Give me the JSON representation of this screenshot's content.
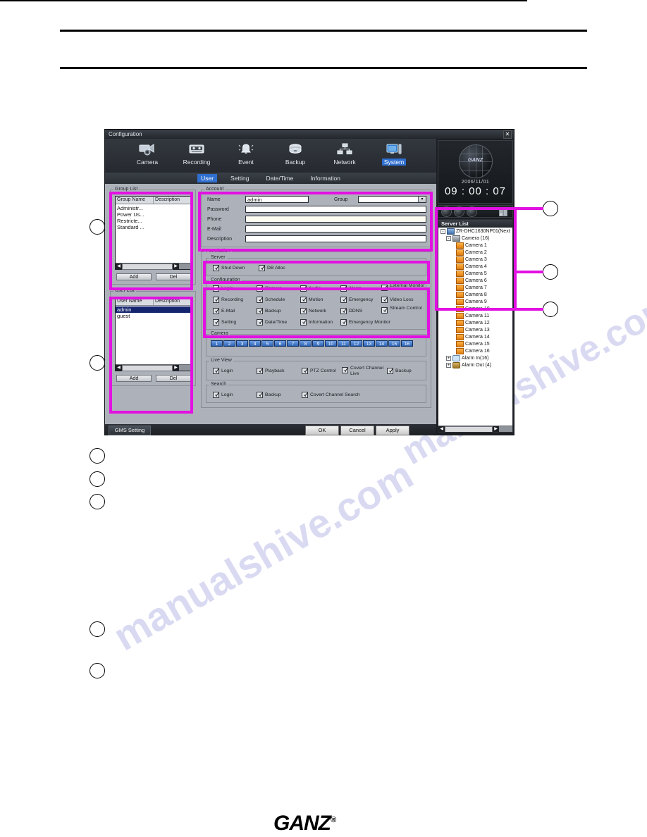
{
  "document": {
    "watermark": "manualshive.com",
    "footer_logo": "GANZ",
    "footer_logo_mark": "®"
  },
  "window": {
    "title": "Configuration",
    "close_label": "✕"
  },
  "toolbar": {
    "items": [
      {
        "label": "Camera",
        "icon": "camera-icon",
        "active": false
      },
      {
        "label": "Recording",
        "icon": "tape-icon",
        "active": false
      },
      {
        "label": "Event",
        "icon": "bell-icon",
        "active": false
      },
      {
        "label": "Backup",
        "icon": "disc-stack-icon",
        "active": false
      },
      {
        "label": "Network",
        "icon": "network-icon",
        "active": false
      },
      {
        "label": "System",
        "icon": "monitor-icon",
        "active": true
      }
    ]
  },
  "subtabs": [
    {
      "label": "User",
      "active": true
    },
    {
      "label": "Setting",
      "active": false
    },
    {
      "label": "Date/Time",
      "active": false
    },
    {
      "label": "Information",
      "active": false
    }
  ],
  "group_list": {
    "title": "Group List",
    "columns": [
      "Group Name",
      "Description"
    ],
    "rows": [
      "Administr...",
      "Power Us...",
      "Restricte...",
      "Standard ..."
    ],
    "add_label": "Add",
    "del_label": "Del"
  },
  "user_list": {
    "title": "User List",
    "columns": [
      "User Name",
      "Description"
    ],
    "rows": [
      {
        "name": "admin",
        "selected": true
      },
      {
        "name": "guest",
        "selected": false
      }
    ],
    "add_label": "Add",
    "del_label": "Del"
  },
  "account": {
    "title": "Account",
    "fields": [
      {
        "label": "Name",
        "value": "admin"
      },
      {
        "label": "Password",
        "value": ""
      },
      {
        "label": "Phone",
        "value": ""
      },
      {
        "label": "E-Mail",
        "value": ""
      },
      {
        "label": "Description",
        "value": ""
      }
    ],
    "group_label": "Group",
    "group_value": ""
  },
  "permission": {
    "title": "Permission",
    "server": {
      "title": "Server",
      "items": [
        {
          "label": "Shut Down",
          "checked": true
        },
        {
          "label": "DB Alloc",
          "checked": true
        }
      ]
    },
    "configuration": {
      "title": "Configuration",
      "items": [
        {
          "label": "Login",
          "checked": true
        },
        {
          "label": "Camera",
          "checked": true
        },
        {
          "label": "Audio",
          "checked": true
        },
        {
          "label": "Alarm",
          "checked": true
        },
        {
          "label": "External Monitor",
          "checked": true
        },
        {
          "label": "Recording",
          "checked": true
        },
        {
          "label": "Schedule",
          "checked": true
        },
        {
          "label": "Motion",
          "checked": true
        },
        {
          "label": "Emergency",
          "checked": true
        },
        {
          "label": "Video Loss",
          "checked": true
        },
        {
          "label": "E-Mail",
          "checked": true
        },
        {
          "label": "Backup",
          "checked": true
        },
        {
          "label": "Network",
          "checked": true
        },
        {
          "label": "DDNS",
          "checked": true
        },
        {
          "label": "Stream Control",
          "checked": true
        },
        {
          "label": "Setting",
          "checked": true
        },
        {
          "label": "Date/Time",
          "checked": true
        },
        {
          "label": "Information",
          "checked": true
        },
        {
          "label": "Emergency Monitor",
          "checked": true
        }
      ]
    },
    "camera": {
      "title": "Camera",
      "channels": [
        "1",
        "2",
        "3",
        "4",
        "5",
        "6",
        "7",
        "8",
        "9",
        "10",
        "11",
        "12",
        "13",
        "14",
        "15",
        "16"
      ]
    },
    "live_view": {
      "title": "Live View",
      "items": [
        {
          "label": "Login",
          "checked": true
        },
        {
          "label": "Playback",
          "checked": true
        },
        {
          "label": "PTZ Control",
          "checked": true
        },
        {
          "label": "Covert Channel Live",
          "checked": true
        },
        {
          "label": "Backup",
          "checked": true
        }
      ]
    },
    "search": {
      "title": "Search",
      "items": [
        {
          "label": "Login",
          "checked": true
        },
        {
          "label": "Backup",
          "checked": true
        },
        {
          "label": "Covert Channel Search",
          "checked": true
        }
      ]
    }
  },
  "dialog_buttons": {
    "gms": "GMS Setting",
    "ok": "OK",
    "cancel": "Cancel",
    "apply": "Apply"
  },
  "clock": {
    "brand": "GANZ",
    "date": "2006/11/01",
    "time": "09 : 00 : 07"
  },
  "server_panel": {
    "title": "Server List",
    "root": "ZR-DHC1630NP01(Next",
    "camera_group": "Camera (16)",
    "cameras": [
      "Camera 1",
      "Camera 2",
      "Camera 3",
      "Camera 4",
      "Camera 5",
      "Camera 6",
      "Camera 7",
      "Camera 8",
      "Camera 9",
      "Camera 10",
      "Camera 11",
      "Camera 12",
      "Camera 13",
      "Camera 14",
      "Camera 15",
      "Camera 16"
    ],
    "alarm_in": "Alarm In(16)",
    "alarm_out": "Alarm Out (4)",
    "expander_collapsed": "+",
    "expander_expanded": "-"
  },
  "colors": {
    "highlight": "#e211e2",
    "accent": "#2f6fd0",
    "panel": "#adb2ba"
  }
}
